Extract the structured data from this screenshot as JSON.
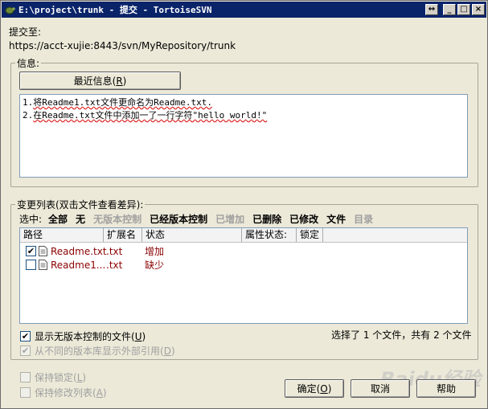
{
  "window": {
    "title": "E:\\project\\trunk - 提交 - TortoiseSVN",
    "resize_glyph": "↔",
    "minimize_glyph": "_",
    "maximize_glyph": "□",
    "close_glyph": "×"
  },
  "commit_to": {
    "label": "提交至:",
    "url": "https://acct-xujie:8443/svn/MyRepository/trunk"
  },
  "message": {
    "group_label": "信息:",
    "recent_button_prefix": "最近信息(",
    "recent_button_key": "R",
    "recent_button_suffix": ")",
    "lines": [
      {
        "prefix": "1.",
        "text": "将Readme1.txt文件更命名为Readme.txt."
      },
      {
        "prefix": "2.",
        "text": "在Readme.txt文件中添加一了一行字符\"hello world!\""
      }
    ]
  },
  "changes": {
    "group_label": "变更列表(双击文件查看差异):",
    "select_label": "选中:",
    "filters": [
      {
        "label": "全部",
        "enabled": true
      },
      {
        "label": "无",
        "enabled": true
      },
      {
        "label": "无版本控制",
        "enabled": false
      },
      {
        "label": "已经版本控制",
        "enabled": true
      },
      {
        "label": "已增加",
        "enabled": false
      },
      {
        "label": "已删除",
        "enabled": true
      },
      {
        "label": "已修改",
        "enabled": true
      },
      {
        "label": "文件",
        "enabled": true
      },
      {
        "label": "目录",
        "enabled": false
      }
    ],
    "columns": [
      "路径",
      "扩展名",
      "状态",
      "属性状态:",
      "锁定"
    ],
    "rows": [
      {
        "checked": true,
        "check_glyph": "✔",
        "path": "Readme.txt",
        "ext": ".txt",
        "status": "增加"
      },
      {
        "checked": false,
        "check_glyph": "",
        "path": "Readme1...",
        "ext": ".txt",
        "status": "缺少"
      }
    ],
    "summary": "选择了 1 个文件，共有 2 个文件"
  },
  "options": {
    "show_unversioned": {
      "label_prefix": "显示无版本控制的文件(",
      "key": "U",
      "label_suffix": ")",
      "checked": true,
      "check_glyph": "✔"
    },
    "show_externals": {
      "label_prefix": "从不同的版本库显示外部引用(",
      "key": "D",
      "label_suffix": ")",
      "checked": true,
      "check_glyph": "✔"
    },
    "keep_locks": {
      "label_prefix": "保持锁定(",
      "key": "L",
      "label_suffix": ")",
      "checked": false
    },
    "keep_changelist": {
      "label_prefix": "保持修改列表(",
      "key": "A",
      "label_suffix": ")",
      "checked": false
    }
  },
  "buttons": {
    "ok_prefix": "确定(",
    "ok_key": "O",
    "ok_suffix": ")",
    "cancel": "取消",
    "help": "帮助"
  },
  "watermark": "Baidu经验"
}
